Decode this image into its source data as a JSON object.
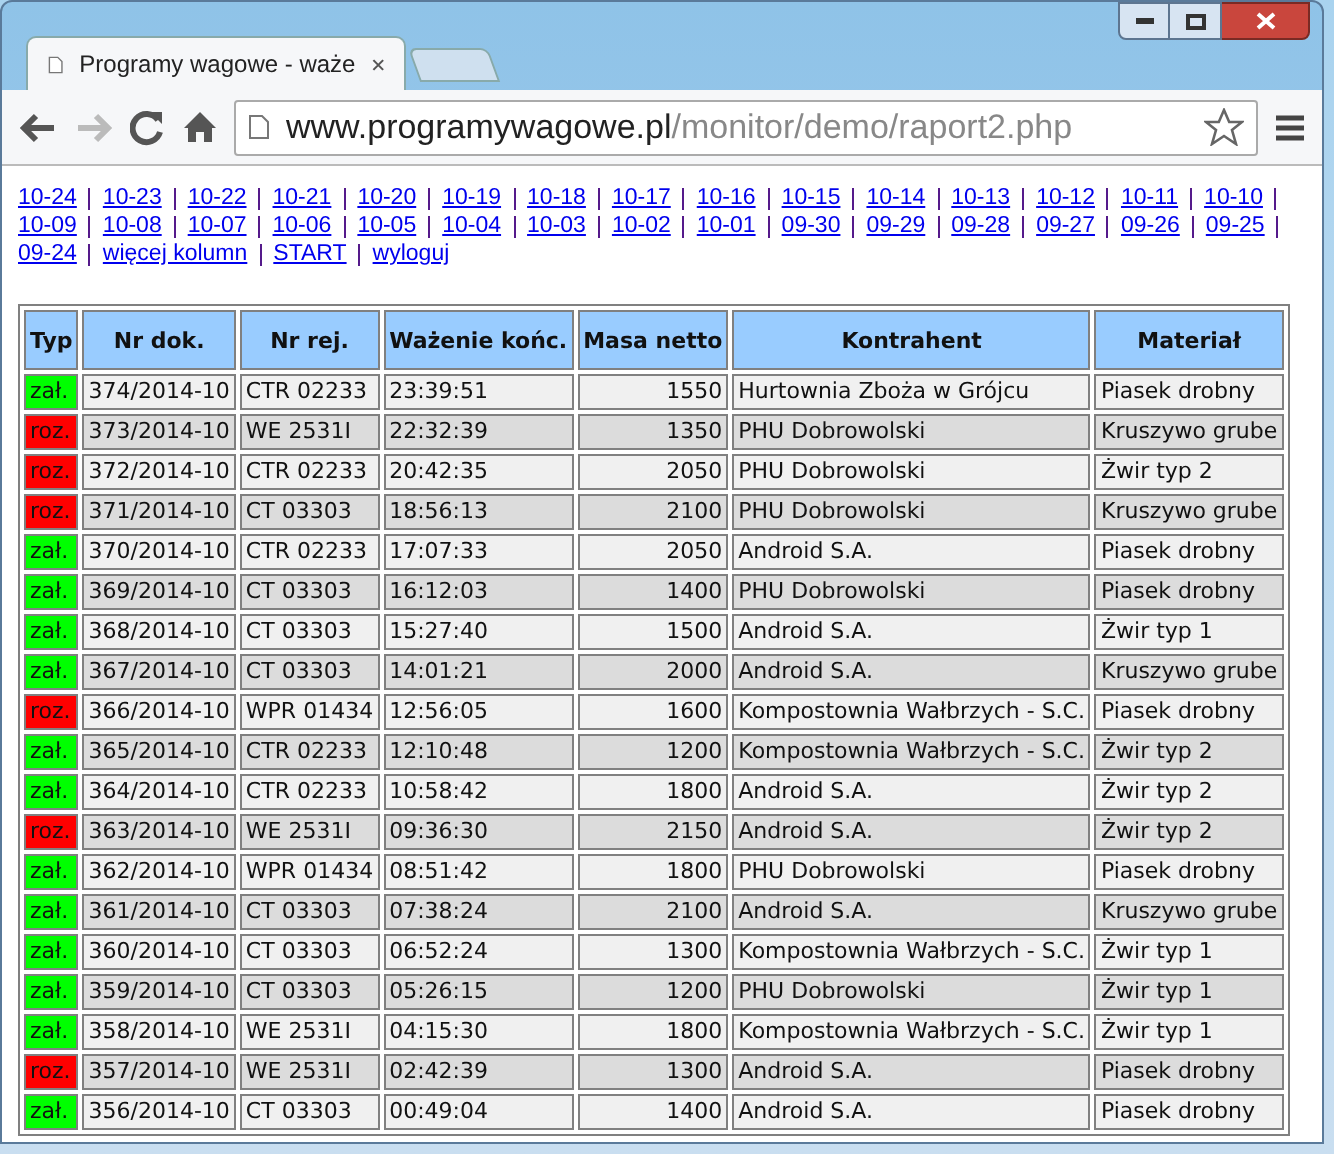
{
  "browser": {
    "tab_title": "Programy wagowe - waże",
    "url_host": "www.programywagowe.pl",
    "url_path": "/monitor/demo/raport2.php"
  },
  "nav_links": [
    "10-24",
    "10-23",
    "10-22",
    "10-21",
    "10-20",
    "10-19",
    "10-18",
    "10-17",
    "10-16",
    "10-15",
    "10-14",
    "10-13",
    "10-12",
    "10-11",
    "10-10",
    "10-09",
    "10-08",
    "10-07",
    "10-06",
    "10-05",
    "10-04",
    "10-03",
    "10-02",
    "10-01",
    "09-30",
    "09-29",
    "09-28",
    "09-27",
    "09-26",
    "09-25",
    "09-24",
    "więcej kolumn",
    "START",
    "wyloguj"
  ],
  "table": {
    "columns": [
      "Typ",
      "Nr dok.",
      "Nr rej.",
      "Ważenie końc.",
      "Masa netto",
      "Kontrahent",
      "Materiał"
    ],
    "rows": [
      {
        "type": "zał.",
        "color": "#00ff00",
        "doc": "374/2014-10",
        "reg": "CTR 02233",
        "time": "23:39:51",
        "mass": "1550",
        "partner": "Hurtownia Zboża w Grójcu",
        "material": "Piasek drobny"
      },
      {
        "type": "roz.",
        "color": "#ff0000",
        "doc": "373/2014-10",
        "reg": "WE 2531I",
        "time": "22:32:39",
        "mass": "1350",
        "partner": "PHU Dobrowolski",
        "material": "Kruszywo grube"
      },
      {
        "type": "roz.",
        "color": "#ff0000",
        "doc": "372/2014-10",
        "reg": "CTR 02233",
        "time": "20:42:35",
        "mass": "2050",
        "partner": "PHU Dobrowolski",
        "material": "Żwir typ 2"
      },
      {
        "type": "roz.",
        "color": "#ff0000",
        "doc": "371/2014-10",
        "reg": "CT 03303",
        "time": "18:56:13",
        "mass": "2100",
        "partner": "PHU Dobrowolski",
        "material": "Kruszywo grube"
      },
      {
        "type": "zał.",
        "color": "#00ff00",
        "doc": "370/2014-10",
        "reg": "CTR 02233",
        "time": "17:07:33",
        "mass": "2050",
        "partner": "Android S.A.",
        "material": "Piasek drobny"
      },
      {
        "type": "zał.",
        "color": "#00ff00",
        "doc": "369/2014-10",
        "reg": "CT 03303",
        "time": "16:12:03",
        "mass": "1400",
        "partner": "PHU Dobrowolski",
        "material": "Piasek drobny"
      },
      {
        "type": "zał.",
        "color": "#00ff00",
        "doc": "368/2014-10",
        "reg": "CT 03303",
        "time": "15:27:40",
        "mass": "1500",
        "partner": "Android S.A.",
        "material": "Żwir typ 1"
      },
      {
        "type": "zał.",
        "color": "#00ff00",
        "doc": "367/2014-10",
        "reg": "CT 03303",
        "time": "14:01:21",
        "mass": "2000",
        "partner": "Android S.A.",
        "material": "Kruszywo grube"
      },
      {
        "type": "roz.",
        "color": "#ff0000",
        "doc": "366/2014-10",
        "reg": "WPR 01434",
        "time": "12:56:05",
        "mass": "1600",
        "partner": "Kompostownia Wałbrzych - S.C.",
        "material": "Piasek drobny"
      },
      {
        "type": "zał.",
        "color": "#00ff00",
        "doc": "365/2014-10",
        "reg": "CTR 02233",
        "time": "12:10:48",
        "mass": "1200",
        "partner": "Kompostownia Wałbrzych - S.C.",
        "material": "Żwir typ 2"
      },
      {
        "type": "zał.",
        "color": "#00ff00",
        "doc": "364/2014-10",
        "reg": "CTR 02233",
        "time": "10:58:42",
        "mass": "1800",
        "partner": "Android S.A.",
        "material": "Żwir typ 2"
      },
      {
        "type": "roz.",
        "color": "#ff0000",
        "doc": "363/2014-10",
        "reg": "WE 2531I",
        "time": "09:36:30",
        "mass": "2150",
        "partner": "Android S.A.",
        "material": "Żwir typ 2"
      },
      {
        "type": "zał.",
        "color": "#00ff00",
        "doc": "362/2014-10",
        "reg": "WPR 01434",
        "time": "08:51:42",
        "mass": "1800",
        "partner": "PHU Dobrowolski",
        "material": "Piasek drobny"
      },
      {
        "type": "zał.",
        "color": "#00ff00",
        "doc": "361/2014-10",
        "reg": "CT 03303",
        "time": "07:38:24",
        "mass": "2100",
        "partner": "Android S.A.",
        "material": "Kruszywo grube"
      },
      {
        "type": "zał.",
        "color": "#00ff00",
        "doc": "360/2014-10",
        "reg": "CT 03303",
        "time": "06:52:24",
        "mass": "1300",
        "partner": "Kompostownia Wałbrzych - S.C.",
        "material": "Żwir typ 1"
      },
      {
        "type": "zał.",
        "color": "#00ff00",
        "doc": "359/2014-10",
        "reg": "CT 03303",
        "time": "05:26:15",
        "mass": "1200",
        "partner": "PHU Dobrowolski",
        "material": "Żwir typ 1"
      },
      {
        "type": "zał.",
        "color": "#00ff00",
        "doc": "358/2014-10",
        "reg": "WE 2531I",
        "time": "04:15:30",
        "mass": "1800",
        "partner": "Kompostownia Wałbrzych - S.C.",
        "material": "Żwir typ 1"
      },
      {
        "type": "roz.",
        "color": "#ff0000",
        "doc": "357/2014-10",
        "reg": "WE 2531I",
        "time": "02:42:39",
        "mass": "1300",
        "partner": "Android S.A.",
        "material": "Piasek drobny"
      },
      {
        "type": "zał.",
        "color": "#00ff00",
        "doc": "356/2014-10",
        "reg": "CT 03303",
        "time": "00:49:04",
        "mass": "1400",
        "partner": "Android S.A.",
        "material": "Piasek drobny"
      }
    ]
  }
}
